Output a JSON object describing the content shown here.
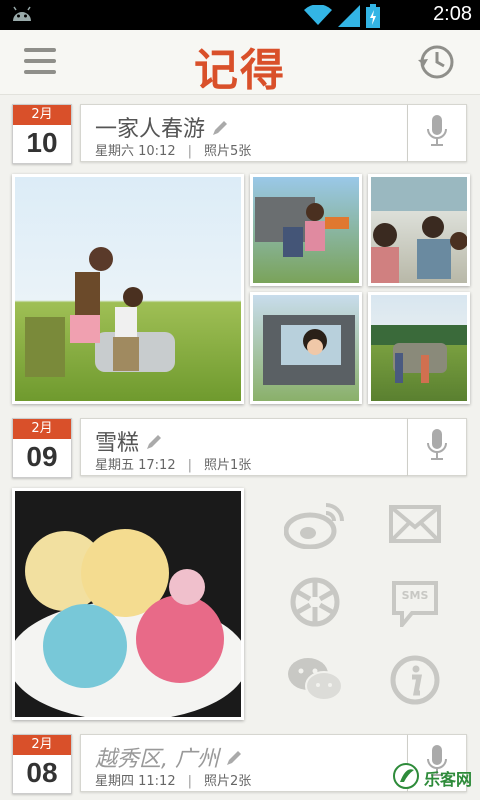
{
  "status_bar": {
    "time": "2:08"
  },
  "app": {
    "title": "记得"
  },
  "entries": [
    {
      "month": "2月",
      "day": "10",
      "title": "一家人春游",
      "weekday_time": "星期六 10:12",
      "separator": "|",
      "photos": "照片5张"
    },
    {
      "month": "2月",
      "day": "09",
      "title": "雪糕",
      "weekday_time": "星期五 17:12",
      "separator": "|",
      "photos": "照片1张"
    },
    {
      "month": "2月",
      "day": "08",
      "title": "越秀区, 广州",
      "weekday_time": "星期四 11:12",
      "separator": "|",
      "photos": "照片2张"
    }
  ],
  "share": {
    "sms_label": "SMS"
  },
  "watermark": {
    "text": "乐客网"
  },
  "icons": [
    "android-icon",
    "wifi-icon",
    "signal-icon",
    "battery-icon",
    "menu-icon",
    "history-icon",
    "pencil-icon",
    "mic-icon",
    "weibo-icon",
    "mail-icon",
    "camera-shutter-icon",
    "sms-icon",
    "wechat-icon",
    "info-icon"
  ]
}
